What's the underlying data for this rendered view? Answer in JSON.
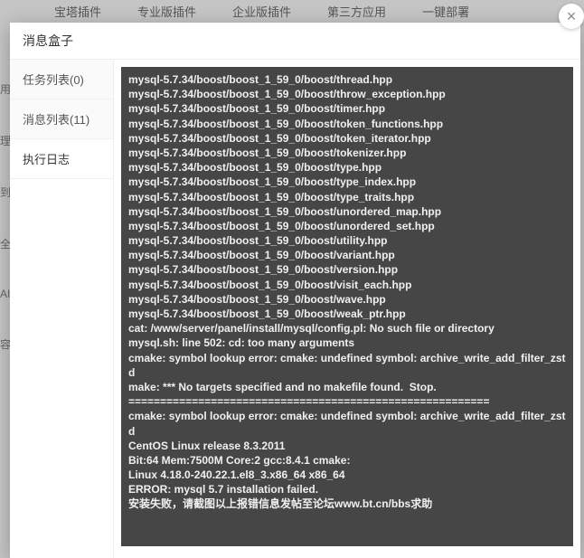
{
  "background": {
    "tabs": [
      "宝塔插件",
      "专业版插件",
      "企业版插件",
      "第三方应用",
      "一键部署"
    ],
    "leftHints": [
      "用",
      "理",
      "到",
      "全",
      "AI",
      "容"
    ]
  },
  "modal": {
    "title": "消息盒子",
    "closeLabel": "×",
    "sideTabs": [
      {
        "label": "任务列表(0)",
        "active": false
      },
      {
        "label": "消息列表(11)",
        "active": false
      },
      {
        "label": "执行日志",
        "active": true
      }
    ],
    "logText": "mysql-5.7.34/boost/boost_1_59_0/boost/thread.hpp\nmysql-5.7.34/boost/boost_1_59_0/boost/throw_exception.hpp\nmysql-5.7.34/boost/boost_1_59_0/boost/timer.hpp\nmysql-5.7.34/boost/boost_1_59_0/boost/token_functions.hpp\nmysql-5.7.34/boost/boost_1_59_0/boost/token_iterator.hpp\nmysql-5.7.34/boost/boost_1_59_0/boost/tokenizer.hpp\nmysql-5.7.34/boost/boost_1_59_0/boost/type.hpp\nmysql-5.7.34/boost/boost_1_59_0/boost/type_index.hpp\nmysql-5.7.34/boost/boost_1_59_0/boost/type_traits.hpp\nmysql-5.7.34/boost/boost_1_59_0/boost/unordered_map.hpp\nmysql-5.7.34/boost/boost_1_59_0/boost/unordered_set.hpp\nmysql-5.7.34/boost/boost_1_59_0/boost/utility.hpp\nmysql-5.7.34/boost/boost_1_59_0/boost/variant.hpp\nmysql-5.7.34/boost/boost_1_59_0/boost/version.hpp\nmysql-5.7.34/boost/boost_1_59_0/boost/visit_each.hpp\nmysql-5.7.34/boost/boost_1_59_0/boost/wave.hpp\nmysql-5.7.34/boost/boost_1_59_0/boost/weak_ptr.hpp\ncat: /www/server/panel/install/mysql/config.pl: No such file or directory\nmysql.sh: line 502: cd: too many arguments\ncmake: symbol lookup error: cmake: undefined symbol: archive_write_add_filter_zstd\nmake: *** No targets specified and no makefile found.  Stop.\n=========================================================\ncmake: symbol lookup error: cmake: undefined symbol: archive_write_add_filter_zstd\nCentOS Linux release 8.3.2011\nBit:64 Mem:7500M Core:2 gcc:8.4.1 cmake:\nLinux 4.18.0-240.22.1.el8_3.x86_64 x86_64\nERROR: mysql 5.7 installation failed.\n安装失败，请截图以上报错信息发帖至论坛www.bt.cn/bbs求助"
  }
}
